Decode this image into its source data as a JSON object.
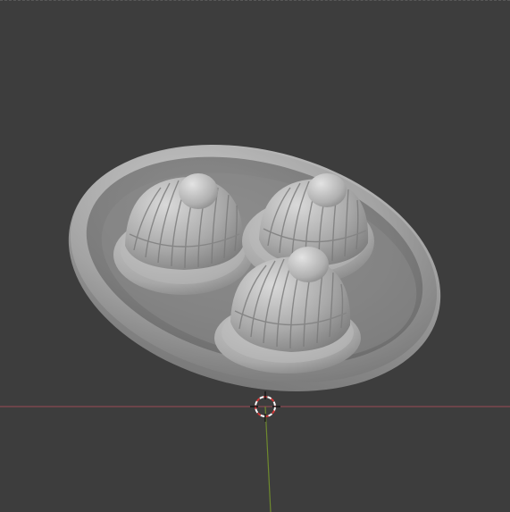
{
  "viewport": {
    "background": "#3d3d3d",
    "x_axis_color": "#9b4a55",
    "y_axis_color": "#6f8a2e",
    "cursor_colors": [
      "#ffffff",
      "#d33a3a"
    ],
    "model_base_color": "#9a9a9a",
    "icons": [
      "3d-cursor-icon"
    ]
  }
}
